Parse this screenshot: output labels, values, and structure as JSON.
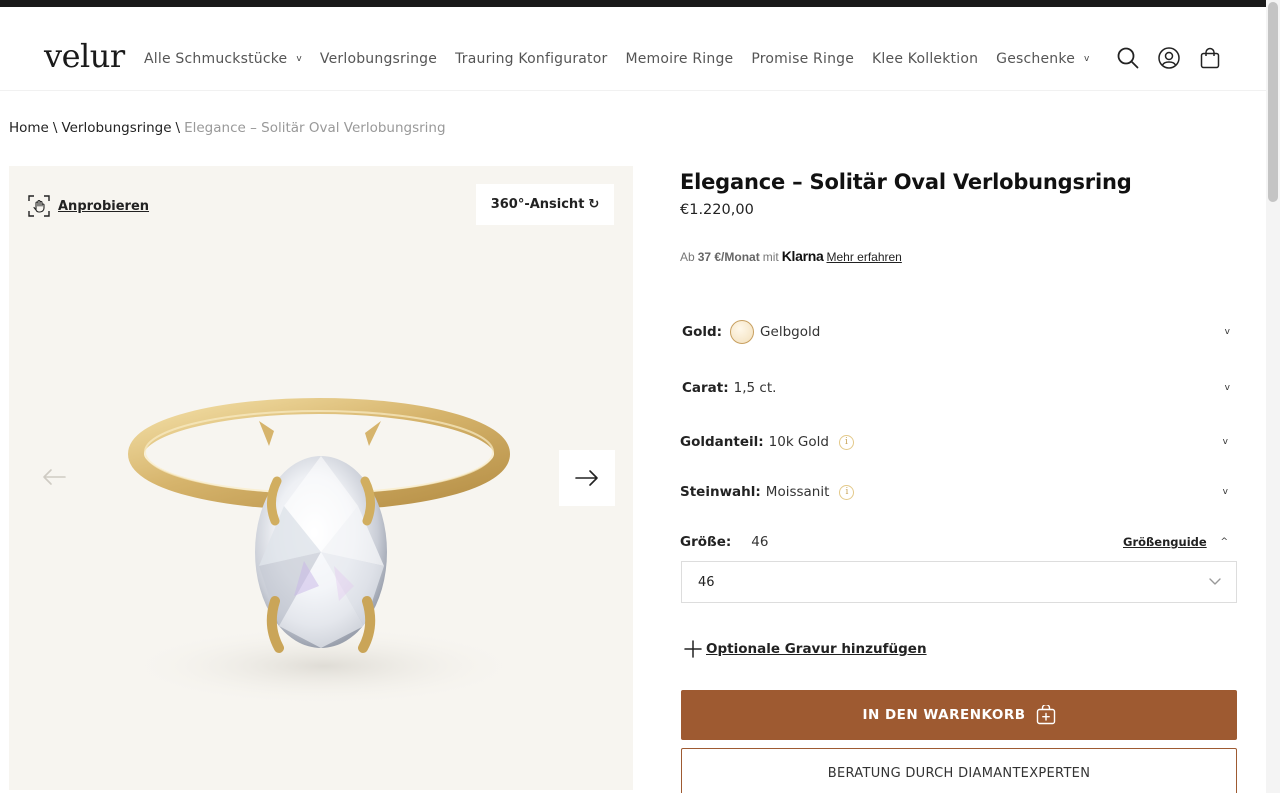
{
  "brand": {
    "logo": "velur"
  },
  "nav": {
    "items": [
      {
        "label": "Alle Schmuckstücke",
        "caret": "v"
      },
      {
        "label": "Verlobungsringe"
      },
      {
        "label": "Trauring Konfigurator"
      },
      {
        "label": "Memoire Ringe"
      },
      {
        "label": "Promise Ringe"
      },
      {
        "label": "Klee Kollektion"
      },
      {
        "label": "Geschenke",
        "caret": "v"
      }
    ],
    "icons": [
      "search-icon",
      "account-icon",
      "cart-icon"
    ]
  },
  "breadcrumb": {
    "items": [
      "Home",
      "Verlobungsringe"
    ],
    "separator": "\\",
    "current": "Elegance – Solitär Oval Verlobungsring"
  },
  "gallery": {
    "tryon_label": "Anprobieren",
    "view360_label": "360°-Ansicht",
    "view360_icon": "↻"
  },
  "product": {
    "title": "Elegance – Solitär Oval Verlobungsring",
    "price": "€1.220,00",
    "klarna": {
      "prefix": "Ab",
      "amount": "37 €/Monat",
      "mid": "mit",
      "brand": "Klarna",
      "link": "Mehr erfahren"
    },
    "options": {
      "gold": {
        "label": "Gold:",
        "value": "Gelbgold",
        "chevron": "v"
      },
      "carat": {
        "label": "Carat:",
        "value": "1,5 ct.",
        "chevron": "v"
      },
      "goldanteil": {
        "label": "Goldanteil:",
        "value": "10k Gold",
        "info": "i",
        "chevron": "v"
      },
      "steinwahl": {
        "label": "Steinwahl:",
        "value": "Moissanit",
        "info": "i",
        "chevron": "v"
      },
      "groesse": {
        "label": "Größe:",
        "value": "46",
        "guide": "Größenguide",
        "chevron": "^"
      }
    },
    "size_select": {
      "selected": "46"
    },
    "engrave_label": "Optionale Gravur hinzufügen",
    "add_to_cart": "IN DEN WARENKORB",
    "consult": "BERATUNG DURCH DIAMANTEXPERTEN"
  },
  "colors": {
    "accent": "#9e5a31",
    "topbar": "#1a1a1a",
    "gallery_bg": "#f7f5f0",
    "gold": "#d4b36a"
  }
}
